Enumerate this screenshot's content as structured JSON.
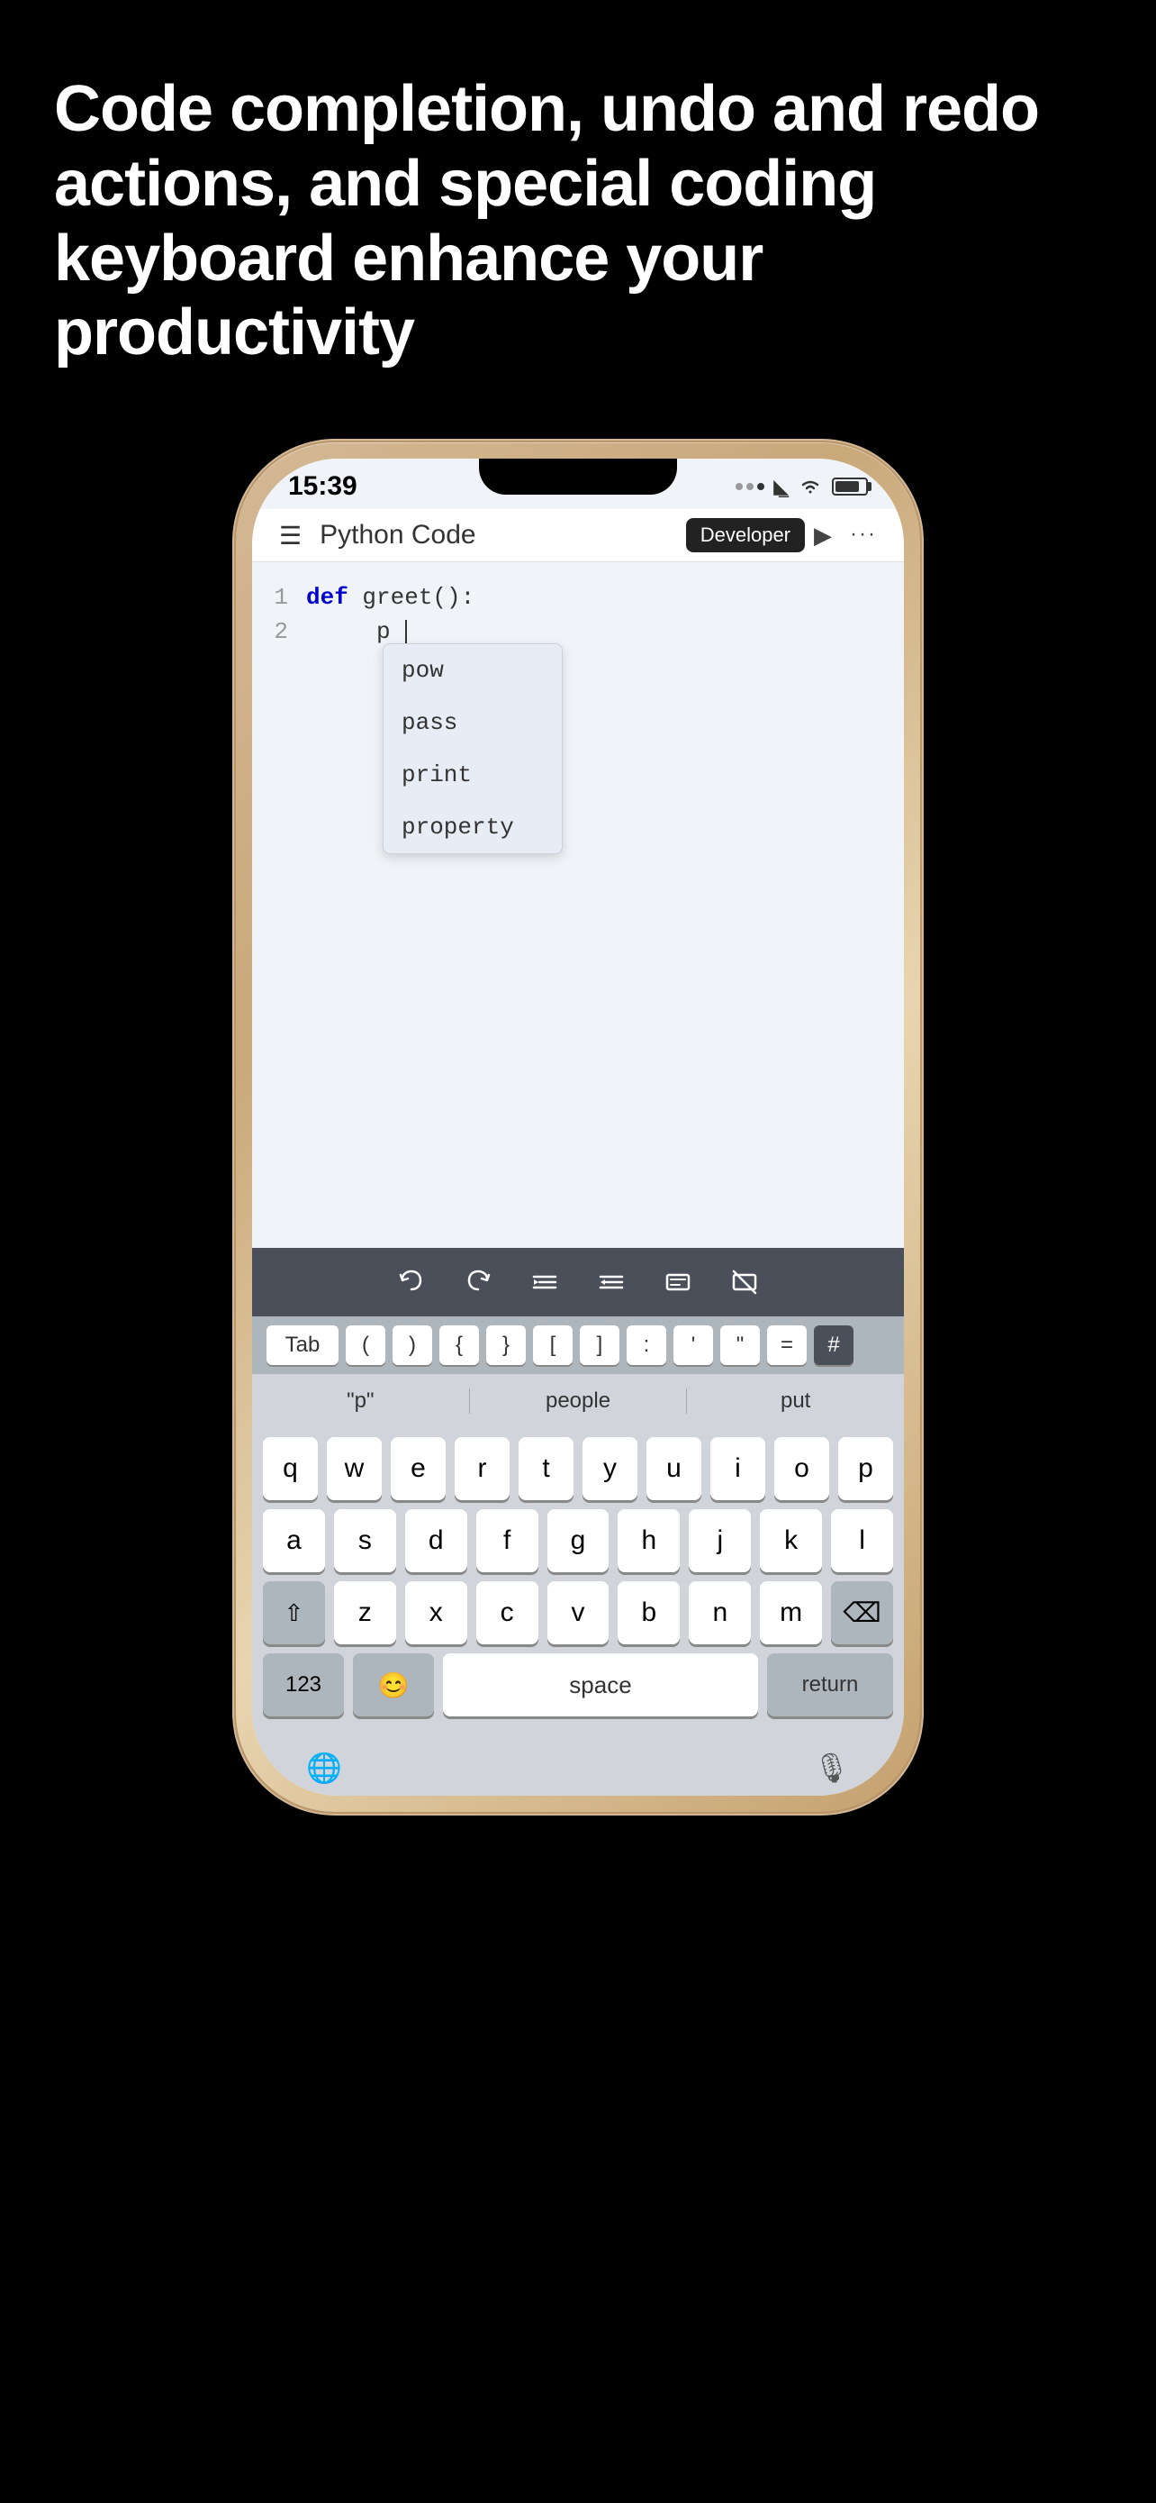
{
  "hero": {
    "title": "Code completion, undo and redo actions, and special coding keyboard enhance your productivity"
  },
  "phone": {
    "status": {
      "time": "15:39",
      "dots": [
        "inactive",
        "inactive",
        "inactive"
      ],
      "wifi": "WiFi",
      "battery": "Battery"
    },
    "header": {
      "menu_icon": "☰",
      "title": "Python Code",
      "badge": "Developer",
      "play_icon": "▶",
      "more_icon": "···"
    },
    "code": {
      "lines": [
        {
          "number": "1",
          "content_parts": [
            {
              "type": "keyword",
              "text": "def"
            },
            {
              "type": "space",
              "text": " "
            },
            {
              "type": "func",
              "text": "greet():"
            }
          ]
        },
        {
          "number": "2",
          "content_parts": [
            {
              "type": "indent",
              "text": "    "
            },
            {
              "type": "normal",
              "text": "p"
            }
          ]
        }
      ]
    },
    "autocomplete": {
      "items": [
        "pow",
        "pass",
        "print",
        "property"
      ]
    },
    "toolbar": {
      "undo_label": "↩",
      "redo_label": "↪",
      "indent_label": "⇥",
      "outdent_label": "⇤",
      "comment_label": "≡",
      "nocomment_label": "⊠"
    },
    "special_keys": {
      "keys": [
        "Tab",
        "(",
        ")",
        "{",
        "}",
        "[",
        "]",
        ":",
        "'",
        "\"",
        "=",
        "#"
      ]
    },
    "predictive": {
      "items": [
        "\"p\"",
        "people",
        "put"
      ]
    },
    "keyboard": {
      "row1": [
        "q",
        "w",
        "e",
        "r",
        "t",
        "y",
        "u",
        "i",
        "o",
        "p"
      ],
      "row2": [
        "a",
        "s",
        "d",
        "f",
        "g",
        "h",
        "j",
        "k",
        "l"
      ],
      "row3": [
        "z",
        "x",
        "c",
        "v",
        "b",
        "n",
        "m"
      ],
      "shift_label": "⇧",
      "delete_label": "⌫",
      "num_label": "123",
      "emoji_label": "😊",
      "space_label": "space",
      "return_label": "return"
    },
    "bottom": {
      "globe_icon": "🌐",
      "mic_icon": "🎙"
    }
  }
}
